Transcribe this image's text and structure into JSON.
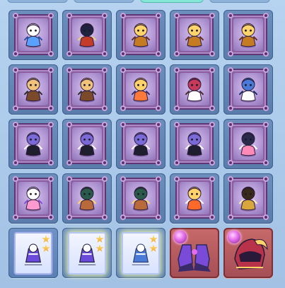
{
  "colors": {
    "page_bg": "#a7c7e8",
    "slot_bg": "#6d8fbd",
    "frame_purple": "#8b5fa0",
    "active_tab": "#86e6d8",
    "equip_slot": "#c86a6a",
    "star_gold": "#f2c23a"
  },
  "top_tabs": [
    {
      "name": "tab-1",
      "active": false
    },
    {
      "name": "tab-2",
      "active": false
    },
    {
      "name": "tab-3",
      "active": true
    },
    {
      "name": "tab-4",
      "active": false
    }
  ],
  "grid": {
    "rows": 5,
    "cols": 5,
    "cells": [
      {
        "kind": "hero",
        "icon": "blue-fox-hero-icon",
        "palette": [
          "#5aa0ff",
          "#ffffff",
          "#2b4fb0"
        ]
      },
      {
        "kind": "hero",
        "icon": "red-ninja-hero-icon",
        "palette": [
          "#c43b2a",
          "#1f2340",
          "#f2d07a"
        ]
      },
      {
        "kind": "hero",
        "icon": "golden-monk-hero-icon",
        "palette": [
          "#c57b22",
          "#ffd46a",
          "#6a2c1b"
        ]
      },
      {
        "kind": "hero",
        "icon": "golden-monk-hero-icon",
        "palette": [
          "#c57b22",
          "#ffd46a",
          "#6a2c1b"
        ]
      },
      {
        "kind": "hero",
        "icon": "golden-monk-hero-icon",
        "palette": [
          "#c57b22",
          "#ffd46a",
          "#6a2c1b"
        ]
      },
      {
        "kind": "hero",
        "icon": "masked-warrior-hero-icon",
        "palette": [
          "#7a4a2a",
          "#f0c27a",
          "#2c2c2c"
        ]
      },
      {
        "kind": "hero",
        "icon": "masked-warrior-hero-icon",
        "palette": [
          "#7a4a2a",
          "#f0c27a",
          "#2c2c2c"
        ]
      },
      {
        "kind": "hero",
        "icon": "fire-mage-hero-icon",
        "palette": [
          "#ff7a3a",
          "#ffd36a",
          "#3a2a6a"
        ]
      },
      {
        "kind": "hero",
        "icon": "archer-girl-hero-icon",
        "palette": [
          "#ffffff",
          "#c83a5a",
          "#4a2a2a"
        ]
      },
      {
        "kind": "hero",
        "icon": "white-panda-hero-icon",
        "palette": [
          "#ffffff",
          "#4a7ad8",
          "#1a2a6a"
        ]
      },
      {
        "kind": "hero",
        "icon": "dark-sorceress-hero-icon",
        "palette": [
          "#1e1e2e",
          "#7a6ad8",
          "#ffffff"
        ]
      },
      {
        "kind": "hero",
        "icon": "dark-sorceress-hero-icon",
        "palette": [
          "#1e1e2e",
          "#7a6ad8",
          "#ffffff"
        ]
      },
      {
        "kind": "hero",
        "icon": "dark-sorceress-hero-icon",
        "palette": [
          "#1e1e2e",
          "#7a6ad8",
          "#ffffff"
        ]
      },
      {
        "kind": "hero",
        "icon": "dark-sorceress-hero-icon",
        "palette": [
          "#1e1e2e",
          "#7a6ad8",
          "#ffffff"
        ]
      },
      {
        "kind": "hero",
        "icon": "pink-dancer-hero-icon",
        "palette": [
          "#ff8ab8",
          "#2a2a4a",
          "#ffffff"
        ]
      },
      {
        "kind": "hero",
        "icon": "pink-fairy-hero-icon",
        "palette": [
          "#ff9ad0",
          "#ffffff",
          "#8a4ad8"
        ]
      },
      {
        "kind": "hero",
        "icon": "bronze-knight-hero-icon",
        "palette": [
          "#b86a3a",
          "#2a5a4a",
          "#ffd36a"
        ]
      },
      {
        "kind": "hero",
        "icon": "bronze-knight-hero-icon",
        "palette": [
          "#b86a3a",
          "#2a5a4a",
          "#ffd36a"
        ]
      },
      {
        "kind": "hero",
        "icon": "flame-fox-hero-icon",
        "palette": [
          "#ff6a2a",
          "#ffd36a",
          "#ffffff"
        ]
      },
      {
        "kind": "hero",
        "icon": "golden-paladin-hero-icon",
        "palette": [
          "#d8a63a",
          "#3a2a1a",
          "#fff2b0"
        ]
      },
      {
        "kind": "item",
        "icon": "purple-ninja-card-icon",
        "stars": 2,
        "glow": false,
        "palette": [
          "#6a4ad8",
          "#1e1e3a",
          "#ffffff"
        ]
      },
      {
        "kind": "item",
        "icon": "purple-ninja-card-icon",
        "stars": 2,
        "glow": true,
        "palette": [
          "#6a4ad8",
          "#1e1e3a",
          "#ffffff"
        ]
      },
      {
        "kind": "item",
        "icon": "blue-wolf-card-icon",
        "stars": 2,
        "glow": true,
        "palette": [
          "#4a7ad8",
          "#2a3a6a",
          "#ffffff"
        ]
      },
      {
        "kind": "equip",
        "icon": "arcane-boots-icon",
        "palette": [
          "#7a4ad8",
          "#2a2a5a",
          "#e46be9"
        ]
      },
      {
        "kind": "equip",
        "icon": "dragon-helm-icon",
        "palette": [
          "#b8324a",
          "#2a1a3a",
          "#ffd36a"
        ]
      }
    ]
  }
}
